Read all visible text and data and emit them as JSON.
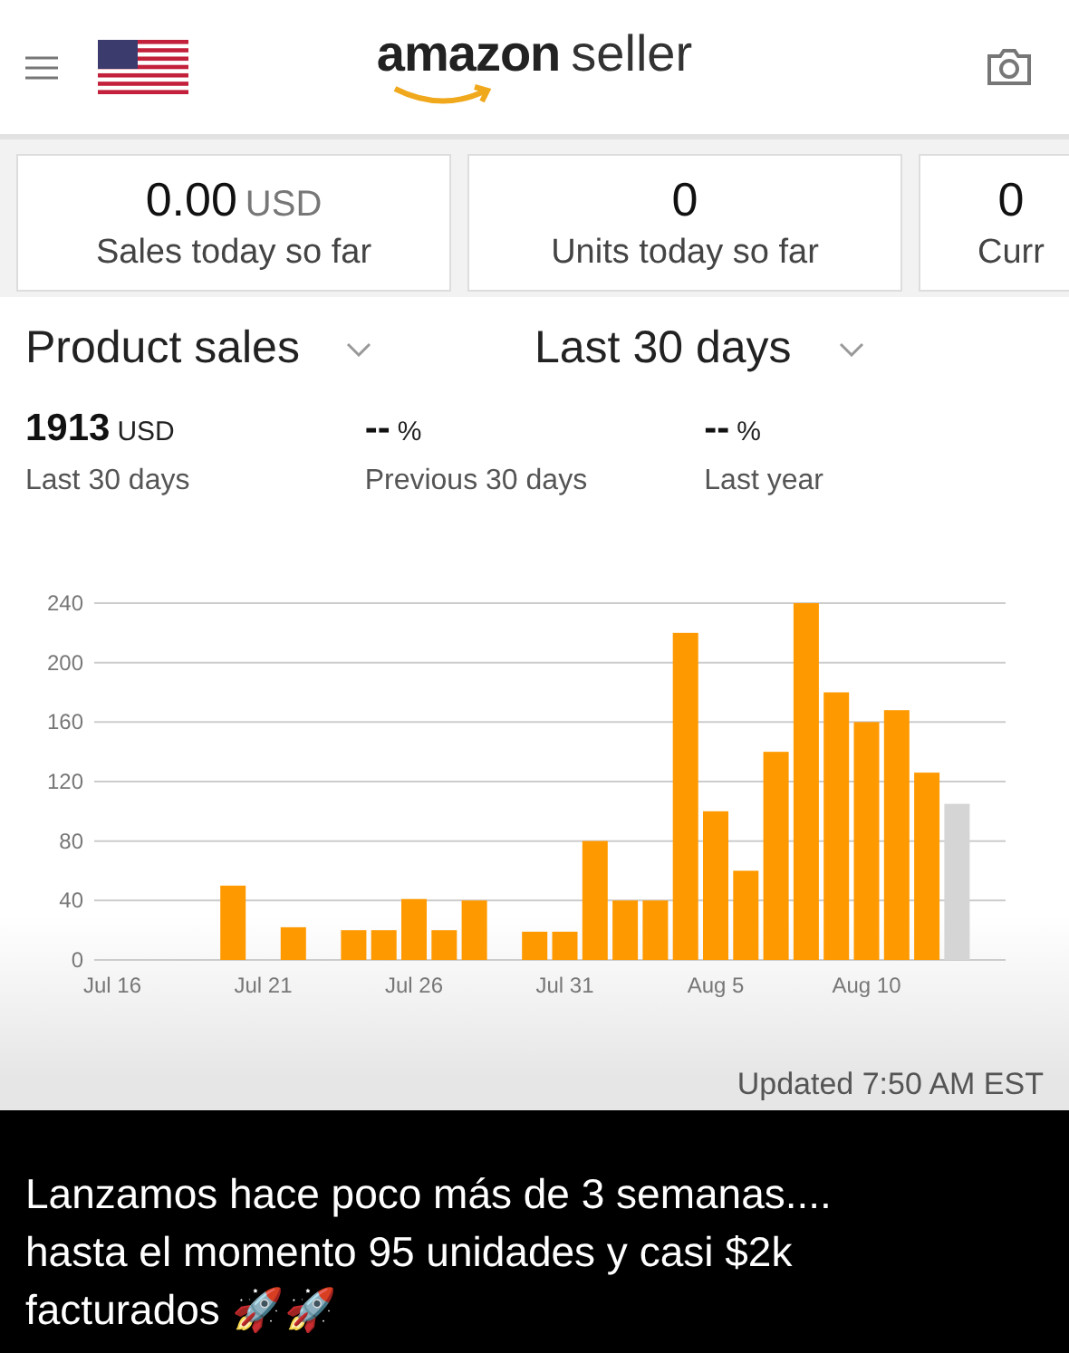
{
  "header": {
    "logo_brand": "amazon",
    "logo_word": "seller"
  },
  "cards": [
    {
      "value": "0.00",
      "unit": "USD",
      "label": "Sales today so far"
    },
    {
      "value": "0",
      "label": "Units today so far"
    },
    {
      "value": "0",
      "label": "Curr"
    }
  ],
  "selectors": [
    {
      "label": "Product sales"
    },
    {
      "label": "Last 30 days"
    }
  ],
  "stats": [
    {
      "value": "1913",
      "unit": "USD",
      "label": "Last 30 days"
    },
    {
      "value": "--",
      "unit": "%",
      "label": "Previous 30 days"
    },
    {
      "value": "--",
      "unit": "%",
      "label": "Last year"
    }
  ],
  "chart": {
    "chart_data": {
      "type": "bar",
      "categories": [
        "Jul 16",
        null,
        null,
        null,
        null,
        "Jul 21",
        null,
        null,
        null,
        null,
        "Jul 26",
        null,
        null,
        null,
        null,
        "Jul 31",
        null,
        null,
        null,
        null,
        "Aug 5",
        null,
        null,
        null,
        null,
        "Aug 10",
        null,
        null,
        null
      ],
      "series": [
        {
          "color": "#ff9900",
          "values": [
            0,
            0,
            0,
            0,
            50,
            0,
            22,
            0,
            20,
            20,
            41,
            20,
            40,
            0,
            19,
            19,
            80,
            40,
            40,
            220,
            100,
            60,
            140,
            240,
            180,
            160,
            168,
            126,
            null
          ]
        },
        {
          "color": "#d5d5d5",
          "values": [
            null,
            null,
            null,
            null,
            null,
            null,
            null,
            null,
            null,
            null,
            null,
            null,
            null,
            null,
            null,
            null,
            null,
            null,
            null,
            null,
            null,
            null,
            null,
            null,
            null,
            null,
            null,
            null,
            105
          ]
        }
      ],
      "grid": true,
      "ylim": [
        0,
        240
      ],
      "yticks": [
        0,
        40,
        80,
        120,
        160,
        200,
        240
      ]
    },
    "updated": "Updated 7:50 AM EST"
  },
  "caption": "Lanzamos hace poco más de 3 semanas.... hasta el momento 95 unidades y casi $2k facturados 🚀🚀"
}
